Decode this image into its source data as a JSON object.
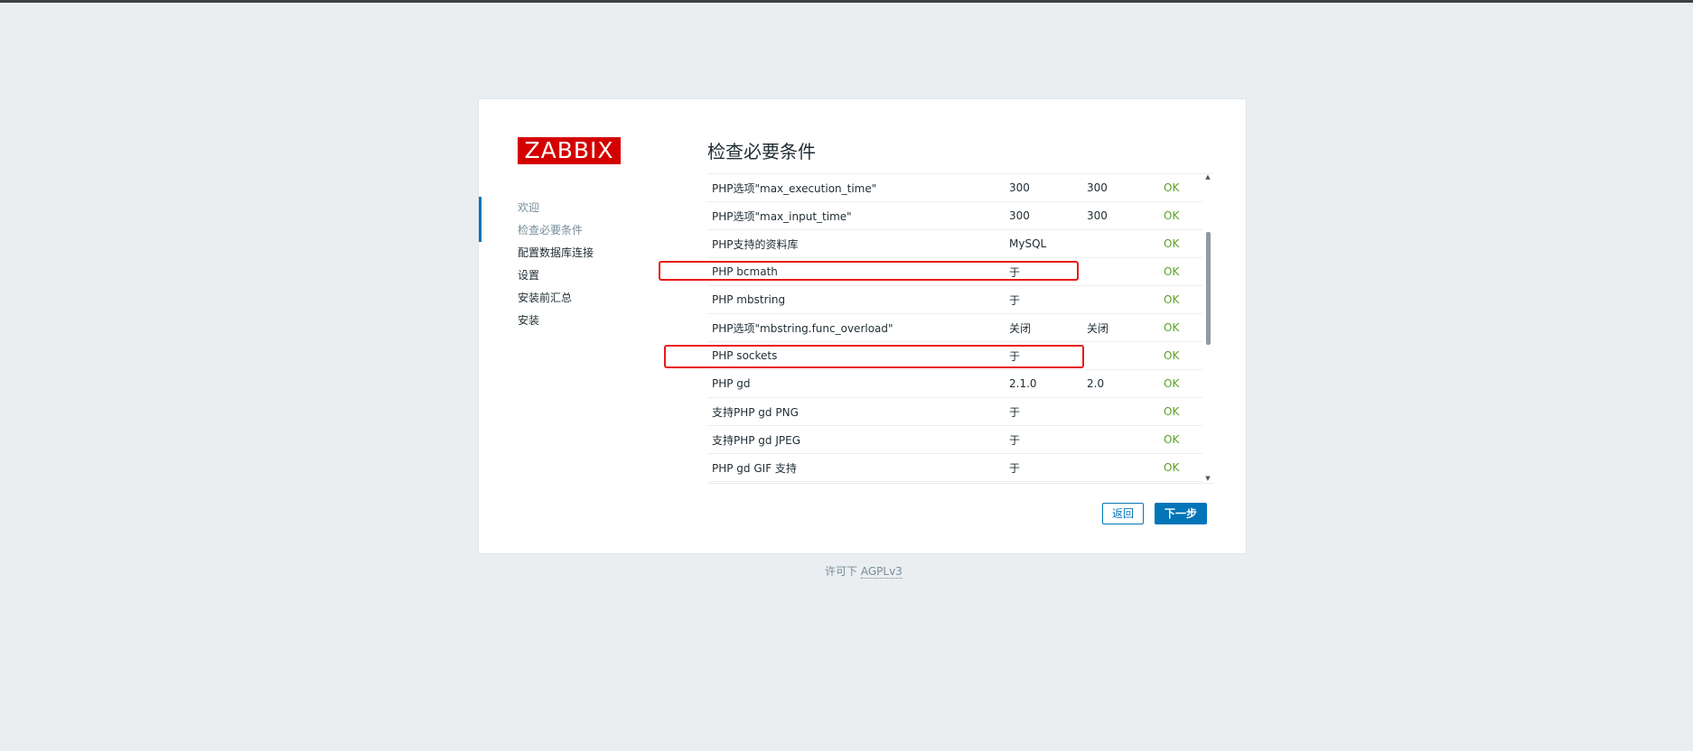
{
  "logo": "ZABBIX",
  "steps": [
    {
      "label": "欢迎",
      "state": "done"
    },
    {
      "label": "检查必要条件",
      "state": "current"
    },
    {
      "label": "配置数据库连接",
      "state": "pending"
    },
    {
      "label": "设置",
      "state": "pending"
    },
    {
      "label": "安装前汇总",
      "state": "pending"
    },
    {
      "label": "安装",
      "state": "pending"
    }
  ],
  "page_title": "检查必要条件",
  "requirements": [
    {
      "name": "PHP选项\"max_execution_time\"",
      "current": "300",
      "required": "300",
      "status": "OK",
      "highlighted": false
    },
    {
      "name": "PHP选项\"max_input_time\"",
      "current": "300",
      "required": "300",
      "status": "OK",
      "highlighted": false
    },
    {
      "name": "PHP支持的资料库",
      "current": "MySQL",
      "required": "",
      "status": "OK",
      "highlighted": false
    },
    {
      "name": "PHP bcmath",
      "current": "于",
      "required": "",
      "status": "OK",
      "highlighted": true
    },
    {
      "name": "PHP mbstring",
      "current": "于",
      "required": "",
      "status": "OK",
      "highlighted": false
    },
    {
      "name": "PHP选项\"mbstring.func_overload\"",
      "current": "关闭",
      "required": "关闭",
      "status": "OK",
      "highlighted": false
    },
    {
      "name": "PHP sockets",
      "current": "于",
      "required": "",
      "status": "OK",
      "highlighted": true
    },
    {
      "name": "PHP gd",
      "current": "2.1.0",
      "required": "2.0",
      "status": "OK",
      "highlighted": false
    },
    {
      "name": "支持PHP gd PNG",
      "current": "于",
      "required": "",
      "status": "OK",
      "highlighted": false
    },
    {
      "name": "支持PHP gd JPEG",
      "current": "于",
      "required": "",
      "status": "OK",
      "highlighted": false
    },
    {
      "name": "PHP gd GIF 支持",
      "current": "于",
      "required": "",
      "status": "OK",
      "highlighted": false
    }
  ],
  "buttons": {
    "back": "返回",
    "next": "下一步"
  },
  "footer": {
    "prefix": "许可下",
    "link": "AGPLv3"
  },
  "colors": {
    "brand_red": "#d40000",
    "accent_blue": "#0275b8",
    "ok_green": "#59a11e",
    "highlight_red": "#e8191c",
    "background": "#ebeef1"
  }
}
